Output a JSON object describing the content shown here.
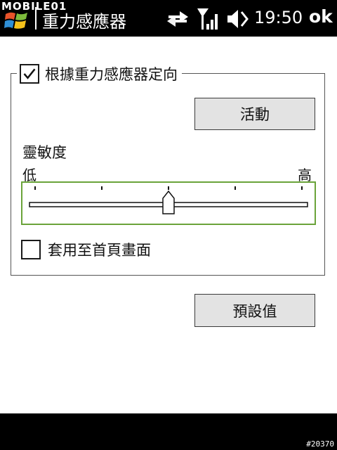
{
  "watermark": "MOBILE01",
  "title_bar": {
    "title": "重力感應器",
    "time": "19:50",
    "ok_label": "ok",
    "icons": [
      "windows-start-icon",
      "sync-icon",
      "signal-icon",
      "volume-icon"
    ]
  },
  "orientation_group": {
    "checkbox_label": "根據重力感應器定向",
    "checked": true,
    "activate_label": "活動",
    "sensitivity_label": "靈敏度",
    "low_label": "低",
    "high_label": "高",
    "slider": {
      "ticks": 5,
      "level": 0.5
    },
    "apply_home_label": "套用至首頁畫面",
    "apply_home_checked": false
  },
  "defaults_label": "預設值",
  "image_number": "#20370",
  "colors": {
    "bar": "#000000",
    "slider_border": "#6aa33a",
    "button_bg": "#e3e3e3"
  }
}
